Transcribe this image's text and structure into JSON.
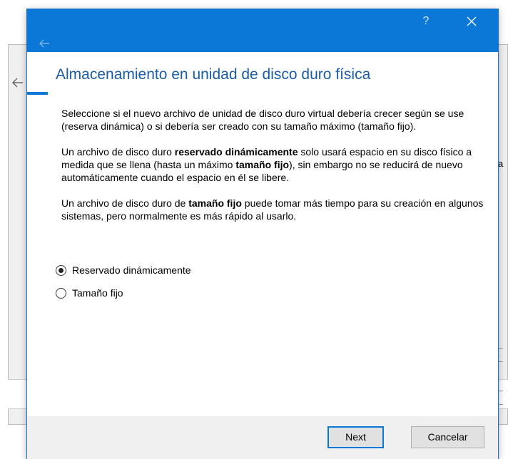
{
  "background_window": {
    "fragment_text": "a"
  },
  "titlebar": {
    "help_label": "?",
    "accent_color": "#0b78d7"
  },
  "page": {
    "title": "Almacenamiento en unidad de disco duro física",
    "paragraph1": "Seleccione si el nuevo archivo de unidad de disco duro virtual debería crecer según se use (reserva dinámica) o si debería ser creado con su tamaño máximo (tamaño fijo).",
    "paragraph2": {
      "t1": "Un archivo de disco duro ",
      "b1": "reservado dinámicamente",
      "t2": " solo usará espacio en su disco físico a medida que se llena (hasta un máximo ",
      "b2": "tamaño fijo",
      "t3": "), sin embargo no se reducirá de nuevo automáticamente cuando el espacio en él se libere."
    },
    "paragraph3": {
      "t1": "Un archivo de disco duro de ",
      "b1": "tamaño fijo",
      "t2": " puede tomar más tiempo para su creación en algunos sistemas, pero normalmente es más rápido al usarlo."
    }
  },
  "options": [
    {
      "label": "Reservado dinámicamente",
      "checked": true
    },
    {
      "label": "Tamaño fijo",
      "checked": false
    }
  ],
  "footer": {
    "next_label": "Next",
    "cancel_label": "Cancelar"
  }
}
